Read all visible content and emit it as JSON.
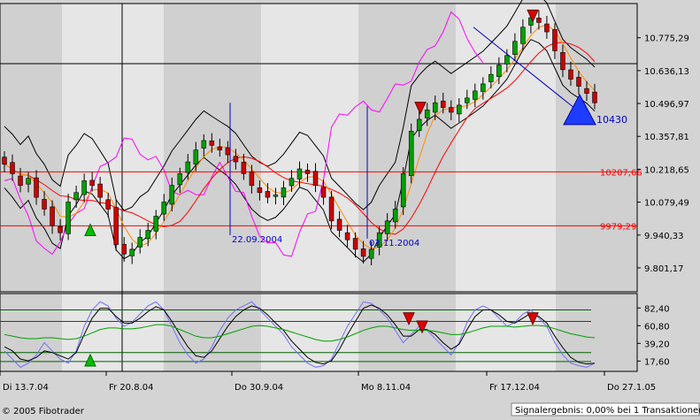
{
  "footer": {
    "copyright": "© 2005 Fibotrader",
    "signal_result": "Signalergebnis: 0,00% bei 1 Transaktionen"
  },
  "colors": {
    "panel_bg": "#e6e6e6",
    "band_bg": "#d0d0d0",
    "up_candle": "#00a000",
    "down_candle": "#d00000",
    "price_line": "#ff00ff",
    "level_line": "#ff0000",
    "ma_line": "#ff8c00",
    "annotation": "#0000cc",
    "oscillator_fast": "#6f6fff",
    "oscillator_green": "#00a000"
  },
  "chart_data": [
    {
      "type": "candlestick",
      "x_tick_labels": [
        "Di 13.7.04",
        "Fr 20.8.04",
        "Do 30.9.04",
        "Mo 8.11.04",
        "Fr 17.12.04",
        "Do 27.1.05"
      ],
      "y_tick_labels": [
        "10.775,29",
        "10.636,13",
        "10.496,97",
        "10.357,81",
        "10.218,65",
        "10.079,49",
        "9.940,33",
        "9.801,17"
      ],
      "ylim": [
        9700,
        10920
      ],
      "horizontal_levels": [
        {
          "label": "10207,66",
          "value": 10207.66,
          "color": "#ff0000"
        },
        {
          "label": "9979,29",
          "value": 9979.29,
          "color": "#ff0000"
        }
      ],
      "annotations": [
        {
          "text": "22.09.2004",
          "date": "22.09.2004",
          "value": 9940
        },
        {
          "text": "03.11.2004",
          "date": "03.11.2004",
          "value": 9925
        },
        {
          "text": "10430",
          "value": 10430
        }
      ],
      "candles_close": [
        10240,
        10200,
        10150,
        10180,
        10100,
        10050,
        9980,
        9950,
        10080,
        10120,
        10170,
        10150,
        10100,
        10050,
        9900,
        9860,
        9880,
        9930,
        9960,
        10020,
        10080,
        10150,
        10200,
        10250,
        10300,
        10340,
        10320,
        10300,
        10280,
        10250,
        10200,
        10150,
        10120,
        10100,
        10110,
        10140,
        10180,
        10220,
        10200,
        10150,
        10100,
        10000,
        9960,
        9920,
        9880,
        9850,
        9880,
        9950,
        10000,
        10050,
        10200,
        10380,
        10430,
        10470,
        10500,
        10480,
        10460,
        10490,
        10520,
        10550,
        10580,
        10620,
        10660,
        10700,
        10760,
        10820,
        10860,
        10840,
        10800,
        10720,
        10640,
        10600,
        10570,
        10540,
        10500
      ]
    },
    {
      "type": "line",
      "title": "",
      "y_tick_labels": [
        "82,40",
        "60,80",
        "39,20",
        "17,60"
      ],
      "ylim": [
        5,
        100
      ],
      "horizontal_levels": [
        80,
        66,
        28,
        17
      ],
      "series": [
        {
          "values": [
            30,
            20,
            10,
            15,
            25,
            40,
            30,
            20,
            15,
            30,
            60,
            80,
            90,
            85,
            70,
            60,
            65,
            75,
            85,
            90,
            80,
            60,
            40,
            25,
            15,
            20,
            35,
            55,
            70,
            80,
            85,
            90,
            80,
            70,
            60,
            50,
            35,
            25,
            15,
            10,
            12,
            20,
            40,
            60,
            75,
            90,
            88,
            80,
            70,
            55,
            40,
            50,
            60,
            55,
            45,
            35,
            25,
            40,
            65,
            80,
            85,
            80,
            70,
            60,
            65,
            75,
            80,
            70,
            60,
            40,
            25,
            15,
            12,
            10,
            15
          ]
        },
        {
          "values": [
            35,
            30,
            20,
            18,
            22,
            30,
            28,
            24,
            20,
            28,
            50,
            70,
            82,
            82,
            72,
            64,
            64,
            70,
            78,
            84,
            80,
            66,
            50,
            35,
            24,
            22,
            30,
            45,
            60,
            72,
            80,
            85,
            82,
            74,
            64,
            55,
            42,
            32,
            22,
            16,
            14,
            18,
            32,
            50,
            66,
            82,
            86,
            82,
            74,
            62,
            48,
            48,
            56,
            56,
            50,
            40,
            32,
            38,
            56,
            72,
            80,
            80,
            74,
            66,
            64,
            70,
            76,
            72,
            64,
            48,
            34,
            22,
            16,
            14,
            15
          ]
        },
        {
          "values": [
            50,
            48,
            46,
            45,
            45,
            46,
            46,
            45,
            44,
            45,
            48,
            52,
            56,
            58,
            58,
            57,
            57,
            58,
            60,
            62,
            62,
            60,
            56,
            52,
            48,
            46,
            46,
            48,
            51,
            54,
            57,
            60,
            61,
            60,
            58,
            56,
            53,
            50,
            47,
            44,
            42,
            42,
            44,
            47,
            51,
            55,
            58,
            60,
            60,
            58,
            56,
            55,
            55,
            55,
            54,
            52,
            50,
            50,
            52,
            55,
            58,
            60,
            60,
            60,
            59,
            60,
            61,
            61,
            60,
            57,
            54,
            51,
            49,
            47,
            46
          ]
        }
      ]
    }
  ]
}
